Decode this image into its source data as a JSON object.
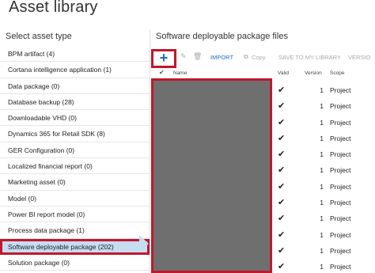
{
  "page": {
    "title": "Asset library"
  },
  "asset_types": {
    "heading": "Select asset type",
    "items": [
      {
        "label": "BPM artifact (4)",
        "selected": false
      },
      {
        "label": "Cortana intelligence application (1)",
        "selected": false
      },
      {
        "label": "Data package (0)",
        "selected": false
      },
      {
        "label": "Database backup (28)",
        "selected": false
      },
      {
        "label": "Downloadable VHD (0)",
        "selected": false
      },
      {
        "label": "Dynamics 365 for Retail SDK (8)",
        "selected": false
      },
      {
        "label": "GER Configuration (0)",
        "selected": false
      },
      {
        "label": "Localized financial report (0)",
        "selected": false
      },
      {
        "label": "Marketing asset (0)",
        "selected": false
      },
      {
        "label": "Model (0)",
        "selected": false
      },
      {
        "label": "Power BI report model (0)",
        "selected": false
      },
      {
        "label": "Process data package (1)",
        "selected": false
      },
      {
        "label": "Software deployable package (202)",
        "selected": true
      },
      {
        "label": "Solution package (0)",
        "selected": false
      }
    ]
  },
  "files": {
    "heading": "Software deployable package files",
    "toolbar": {
      "add_label": "+",
      "edit_icon": "pencil-icon",
      "delete_icon": "trash-icon",
      "import_label": "IMPORT",
      "copy_icon": "copy-icon",
      "copy_label": "Copy",
      "save_label": "SAVE TO MY LIBRARY",
      "version_label": "VERSIO"
    },
    "columns": {
      "check": "✔",
      "name": "Name",
      "valid": "Valid",
      "version": "Version",
      "scope": "Scope"
    },
    "rows": [
      {
        "valid": "✔",
        "version": "1",
        "scope": "Project"
      },
      {
        "valid": "✔",
        "version": "1",
        "scope": "Project"
      },
      {
        "valid": "✔",
        "version": "1",
        "scope": "Project"
      },
      {
        "valid": "✔",
        "version": "1",
        "scope": "Project"
      },
      {
        "valid": "✔",
        "version": "1",
        "scope": "Project"
      },
      {
        "valid": "✔",
        "version": "1",
        "scope": "Project"
      },
      {
        "valid": "✔",
        "version": "1",
        "scope": "Project"
      },
      {
        "valid": "✔",
        "version": "1",
        "scope": "Project"
      },
      {
        "valid": "✔",
        "version": "1",
        "scope": "Project"
      },
      {
        "valid": "✔",
        "version": "1",
        "scope": "Project"
      },
      {
        "valid": "✔",
        "version": "1",
        "scope": "Project"
      },
      {
        "valid": "✔",
        "version": "1",
        "scope": "Project"
      }
    ]
  },
  "colors": {
    "accent": "#1b6fc2",
    "highlight_border": "#c0182b",
    "selected_bg": "#c6dcf1",
    "redacted": "#6f6f6f"
  }
}
